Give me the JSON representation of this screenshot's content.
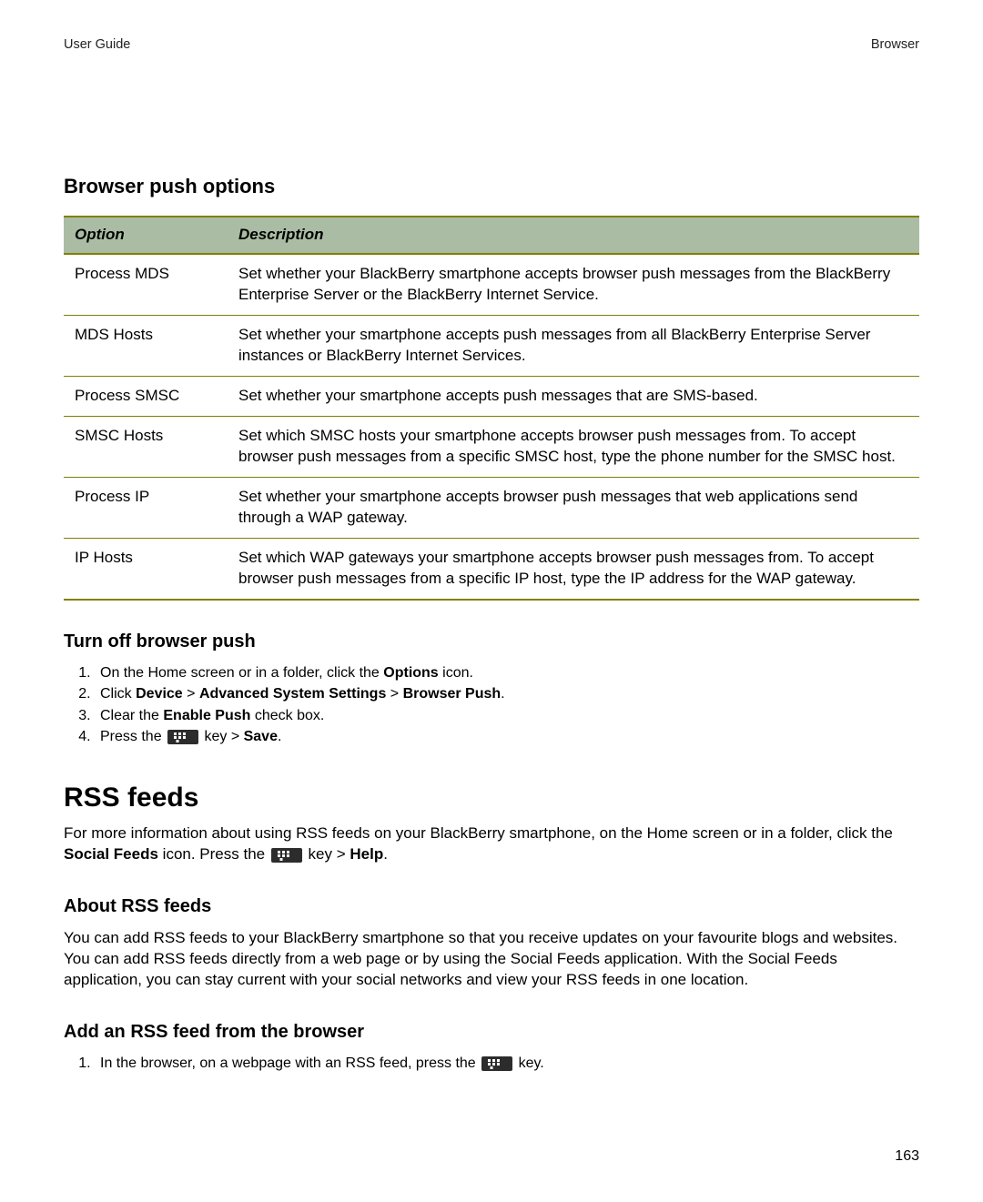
{
  "header": {
    "left": "User Guide",
    "right": "Browser"
  },
  "section1_title": "Browser push options",
  "table": {
    "header_option": "Option",
    "header_description": "Description",
    "rows": [
      {
        "option": "Process MDS",
        "desc": "Set whether your BlackBerry smartphone accepts browser push messages from the BlackBerry Enterprise Server or the BlackBerry Internet Service."
      },
      {
        "option": "MDS Hosts",
        "desc": "Set whether your smartphone accepts push messages from all BlackBerry Enterprise Server instances or BlackBerry Internet Services."
      },
      {
        "option": "Process SMSC",
        "desc": "Set whether your smartphone accepts push messages that are SMS-based."
      },
      {
        "option": "SMSC Hosts",
        "desc": "Set which SMSC hosts your smartphone accepts browser push messages from. To accept browser push messages from a specific SMSC host, type the phone number for the SMSC host."
      },
      {
        "option": "Process IP",
        "desc": "Set whether your smartphone accepts browser push messages that web applications send through a WAP gateway."
      },
      {
        "option": "IP Hosts",
        "desc": "Set which WAP gateways your smartphone accepts browser push messages from. To accept browser push messages from a specific IP host, type the IP address for the WAP gateway."
      }
    ]
  },
  "section2_title": "Turn off browser push",
  "steps_turn_off": {
    "s1_pre": "On the Home screen or in a folder, click the ",
    "s1_bold": "Options",
    "s1_post": " icon.",
    "s2_pre": "Click ",
    "s2_b1": "Device",
    "s2_mid1": " > ",
    "s2_b2": "Advanced System Settings",
    "s2_mid2": " > ",
    "s2_b3": "Browser Push",
    "s2_post": ".",
    "s3_pre": "Clear the ",
    "s3_bold": "Enable Push",
    "s3_post": " check box.",
    "s4_pre": "Press the ",
    "s4_mid": " key > ",
    "s4_bold": "Save",
    "s4_post": "."
  },
  "chapter_title": "RSS feeds",
  "rss_intro": {
    "pre": "For more information about using RSS feeds on your BlackBerry smartphone, on the Home screen or in a folder, click the ",
    "b1": "Social Feeds",
    "mid1": " icon. Press the ",
    "mid2": " key > ",
    "b2": "Help",
    "post": "."
  },
  "about_title": "About RSS feeds",
  "about_text": "You can add RSS feeds to your BlackBerry smartphone so that you receive updates on your favourite blogs and websites. You can add RSS feeds directly from a web page or by using the Social Feeds application. With the Social Feeds application, you can stay current with your social networks and view your RSS feeds in one location.",
  "add_title": "Add an RSS feed from the browser",
  "add_step": {
    "pre": "In the browser, on a webpage with an RSS feed, press the ",
    "post": " key."
  },
  "page_number": "163"
}
